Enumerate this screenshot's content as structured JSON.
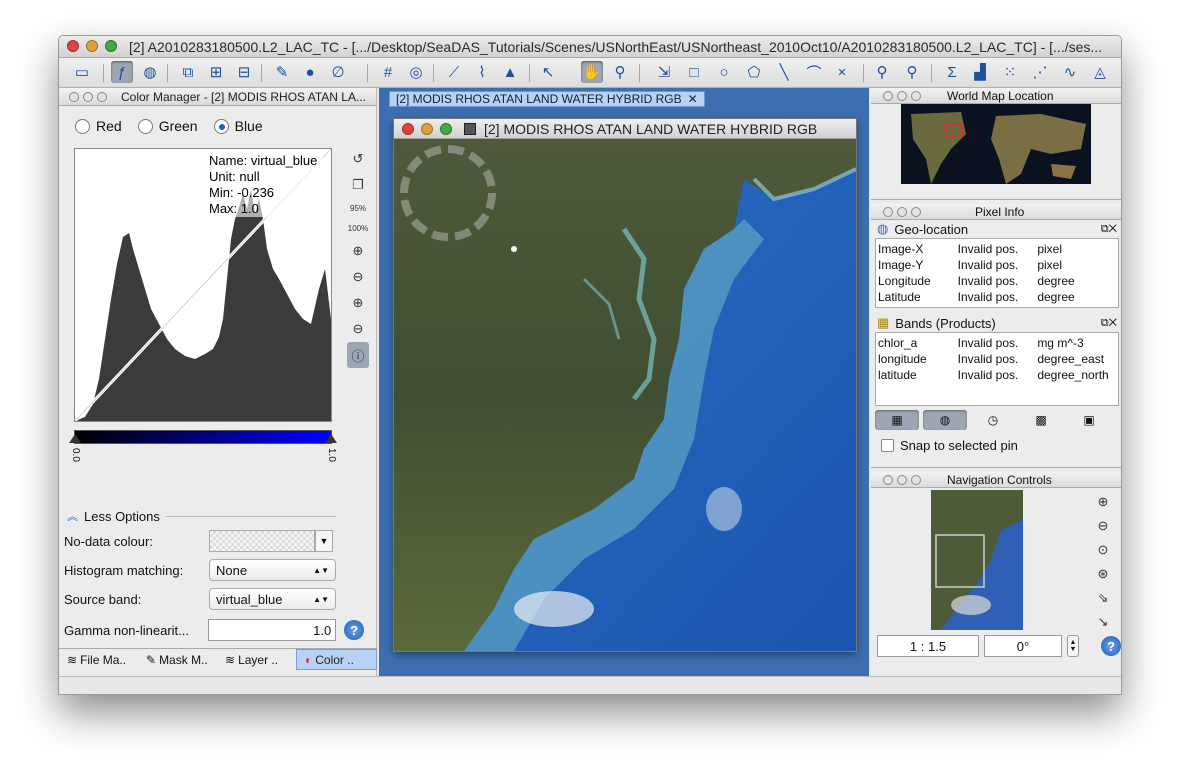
{
  "window": {
    "title": "[2] A2010283180500.L2_LAC_TC - [.../Desktop/SeaDAS_Tutorials/Scenes/USNorthEast/USNortheast_2010Oct10/A2010283180500.L2_LAC_TC] - [.../ses..."
  },
  "color_manager": {
    "title": "Color Manager - [2] MODIS RHOS ATAN LA...",
    "radio": {
      "red": "Red",
      "green": "Green",
      "blue": "Blue",
      "selected": "Blue"
    },
    "info": {
      "name": "Name: virtual_blue",
      "unit": "Unit: null",
      "min": "Min: -0.236",
      "max": "Max: 1.0"
    },
    "slider_min_label": "0.0",
    "slider_max_label": "1.0",
    "zoom_95": "95%",
    "zoom_100": "100%",
    "less_options": "Less Options",
    "nodata_label": "No-data colour:",
    "hist_match_label": "Histogram matching:",
    "hist_match_value": "None",
    "source_band_label": "Source band:",
    "source_band_value": "virtual_blue",
    "gamma_label": "Gamma non-linearit...",
    "gamma_value": "1.0"
  },
  "bottom_tabs": [
    {
      "label": "File Ma.."
    },
    {
      "label": "Mask M.."
    },
    {
      "label": "Layer .."
    },
    {
      "label": "Color .."
    }
  ],
  "viewer": {
    "tab_label": "[2] MODIS RHOS ATAN LAND WATER HYBRID RGB",
    "window_title": "[2] MODIS RHOS ATAN LAND WATER HYBRID RGB"
  },
  "world_map": {
    "title": "World Map Location"
  },
  "pixel_info": {
    "title": "Pixel Info",
    "geo_title": "Geo-location",
    "geo_rows": [
      {
        "name": "Image-X",
        "value": "Invalid pos.",
        "unit": "pixel"
      },
      {
        "name": "Image-Y",
        "value": "Invalid pos.",
        "unit": "pixel"
      },
      {
        "name": "Longitude",
        "value": "Invalid pos.",
        "unit": "degree"
      },
      {
        "name": "Latitude",
        "value": "Invalid pos.",
        "unit": "degree"
      }
    ],
    "bands_title": "Bands (Products)",
    "band_rows": [
      {
        "name": "chlor_a",
        "value": "Invalid pos.",
        "unit": "mg m^-3"
      },
      {
        "name": "longitude",
        "value": "Invalid pos.",
        "unit": "degree_east"
      },
      {
        "name": "latitude",
        "value": "Invalid pos.",
        "unit": "degree_north"
      }
    ],
    "snap_label": "Snap to selected pin"
  },
  "navigation": {
    "title": "Navigation Controls",
    "scale": "1 : 1.5",
    "rotation": "0°"
  },
  "colors": {
    "accent": "#3d6fb0",
    "selected_tab": "#b9d1f2"
  }
}
